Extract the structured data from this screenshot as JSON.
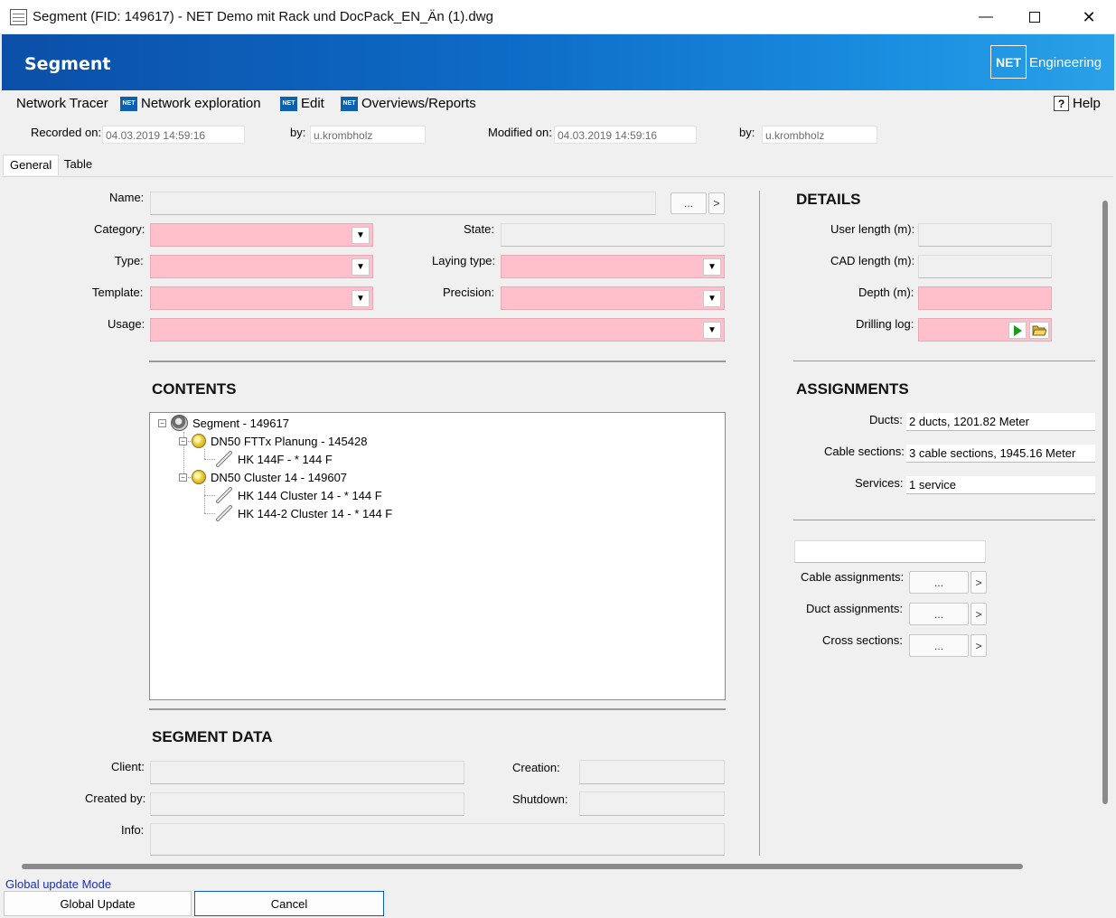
{
  "window": {
    "title": "Segment (FID: 149617) - NET Demo mit Rack und DocPack_EN_Än (1).dwg"
  },
  "banner": {
    "heading": "Segment",
    "logo": "NET",
    "brand": "Engineering"
  },
  "toolbar": {
    "network_tracer": "Network Tracer",
    "network_exploration": "Network exploration",
    "edit": "Edit",
    "overviews": "Overviews/Reports",
    "help": "Help"
  },
  "meta": {
    "recorded_label": "Recorded on:",
    "recorded_value": "04.03.2019 14:59:16",
    "by_label": "by:",
    "by_value": "u.krombholz",
    "modified_label": "Modified on:",
    "modified_value": "04.03.2019 14:59:16",
    "by2_label": "by:",
    "by2_value": "u.krombholz"
  },
  "tabs": [
    "General",
    "Table"
  ],
  "form": {
    "name_label": "Name:",
    "category_label": "Category:",
    "state_label": "State:",
    "type_label": "Type:",
    "laying_label": "Laying type:",
    "template_label": "Template:",
    "precision_label": "Precision:",
    "usage_label": "Usage:",
    "ellipsis": "...",
    "arrow": ">"
  },
  "contents": {
    "heading": "CONTENTS",
    "tree": [
      {
        "label": "Segment - 149617",
        "icon": "segment-icon"
      },
      {
        "label": "DN50 FTTx Planung - 145428",
        "icon": "duct-icon"
      },
      {
        "label": "HK 144F - * 144 F",
        "icon": "cable-icon"
      },
      {
        "label": "DN50 Cluster 14 - 149607",
        "icon": "duct-icon"
      },
      {
        "label": "HK 144 Cluster 14 - * 144 F",
        "icon": "cable-icon"
      },
      {
        "label": "HK 144-2 Cluster 14 - * 144 F",
        "icon": "cable-icon"
      }
    ]
  },
  "segment_data": {
    "heading": "SEGMENT DATA",
    "client_label": "Client:",
    "created_by_label": "Created by:",
    "info_label": "Info:",
    "creation_label": "Creation:",
    "shutdown_label": "Shutdown:"
  },
  "details": {
    "heading": "DETAILS",
    "user_length_label": "User length (m):",
    "cad_length_label": "CAD length (m):",
    "depth_label": "Depth (m):",
    "drilling_log_label": "Drilling log:"
  },
  "assignments": {
    "heading": "ASSIGNMENTS",
    "ducts_label": "Ducts:",
    "ducts_value": "2 ducts, 1201.82 Meter",
    "cables_label": "Cable sections:",
    "cables_value": "3 cable sections, 1945.16 Meter",
    "services_label": "Services:",
    "services_value": "1 service",
    "cable_assign_label": "Cable assignments:",
    "duct_assign_label": "Duct assignments:",
    "cross_label": "Cross sections:"
  },
  "footer": {
    "mode": "Global update Mode",
    "global_update": "Global Update",
    "cancel": "Cancel"
  },
  "colors": {
    "required_field": "#ffc0cb",
    "banner": "#0b4fa8",
    "mode_text": "#1a2fb0"
  }
}
